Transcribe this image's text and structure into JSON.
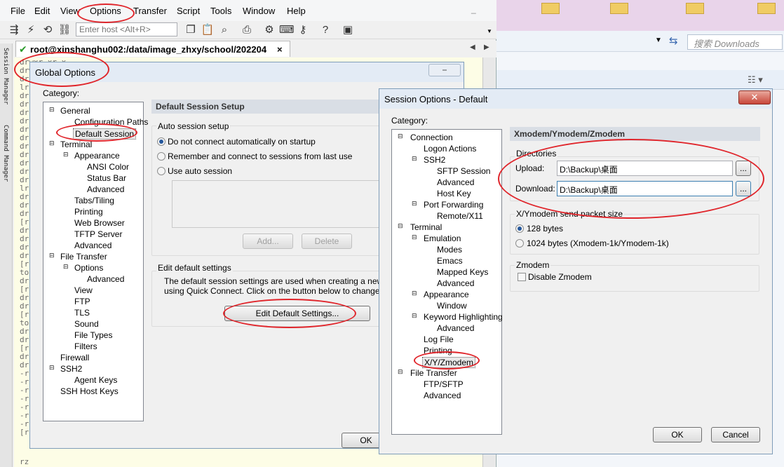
{
  "menubar": {
    "items": [
      "File",
      "Edit",
      "View",
      "Options",
      "Transfer",
      "Script",
      "Tools",
      "Window",
      "Help"
    ]
  },
  "toolbar": {
    "host_placeholder": "Enter host <Alt+R>"
  },
  "session_tab": {
    "label": "root@xinshanghu002:/data/image_zhxy/school/202204",
    "close": "×"
  },
  "side_tabs": [
    "Session Manager",
    "Command Manager"
  ],
  "terminal": {
    "lines": [
      "drwxr-xr-x",
      "drwxr-xr-x",
      "dr",
      "lr",
      "dr",
      "dr",
      "dr",
      "dr",
      "dr",
      "dr",
      "dr",
      "dr",
      "dr",
      "dr",
      "dr",
      "lr",
      "dr",
      "dr",
      "dr",
      "[r",
      "dr",
      "dr",
      "dr",
      "dr",
      "[r",
      "to",
      "dr",
      "[r",
      "dr",
      "dr",
      "[r",
      "to",
      "dr",
      "dr",
      "[r",
      "dr",
      "dr",
      "-r",
      "-r",
      "-r",
      "-r",
      "-r",
      "-r",
      "-r",
      "[r",
      "rz"
    ]
  },
  "explorer": {
    "search_placeholder": "搜索 Downloads"
  },
  "global_options": {
    "title": "Global Options",
    "category_label": "Category:",
    "tree": [
      {
        "label": "General",
        "level": 0,
        "expander": "-"
      },
      {
        "label": "Configuration Paths",
        "level": 1
      },
      {
        "label": "Default Session",
        "level": 1,
        "selected": true
      },
      {
        "label": "Terminal",
        "level": 0,
        "expander": "-"
      },
      {
        "label": "Appearance",
        "level": 1,
        "expander": "-"
      },
      {
        "label": "ANSI Color",
        "level": 2
      },
      {
        "label": "Status Bar",
        "level": 2
      },
      {
        "label": "Advanced",
        "level": 2
      },
      {
        "label": "Tabs/Tiling",
        "level": 1
      },
      {
        "label": "Printing",
        "level": 1
      },
      {
        "label": "Web Browser",
        "level": 1
      },
      {
        "label": "TFTP Server",
        "level": 1
      },
      {
        "label": "Advanced",
        "level": 1
      },
      {
        "label": "File Transfer",
        "level": 0,
        "expander": "-"
      },
      {
        "label": "Options",
        "level": 1,
        "expander": "-"
      },
      {
        "label": "Advanced",
        "level": 2
      },
      {
        "label": "View",
        "level": 1
      },
      {
        "label": "FTP",
        "level": 1
      },
      {
        "label": "TLS",
        "level": 1
      },
      {
        "label": "Sound",
        "level": 1
      },
      {
        "label": "File Types",
        "level": 1
      },
      {
        "label": "Filters",
        "level": 1
      },
      {
        "label": "Firewall",
        "level": 0
      },
      {
        "label": "SSH2",
        "level": 0,
        "expander": "-"
      },
      {
        "label": "Agent Keys",
        "level": 1
      },
      {
        "label": "SSH Host Keys",
        "level": 0
      }
    ],
    "header": "Default Session Setup",
    "auto_group": "Auto session setup",
    "radio_1": "Do not connect automatically on startup",
    "radio_2": "Remember and connect to sessions from last use",
    "radio_3": "Use auto session",
    "add_button": "Add...",
    "delete_button": "Delete",
    "edit_group": "Edit default settings",
    "desc_1": "The default session settings are used when creating a new sess",
    "desc_2": "using Quick Connect.  Click on the button below to change the d",
    "edit_button": "Edit Default Settings...",
    "ok_button": "OK"
  },
  "session_options": {
    "title": "Session Options - Default",
    "category_label": "Category:",
    "tree": [
      {
        "label": "Connection",
        "level": 0,
        "expander": "-"
      },
      {
        "label": "Logon Actions",
        "level": 1
      },
      {
        "label": "SSH2",
        "level": 1,
        "expander": "-"
      },
      {
        "label": "SFTP Session",
        "level": 2
      },
      {
        "label": "Advanced",
        "level": 2
      },
      {
        "label": "Host Key",
        "level": 2
      },
      {
        "label": "Port Forwarding",
        "level": 1,
        "expander": "-"
      },
      {
        "label": "Remote/X11",
        "level": 2
      },
      {
        "label": "Terminal",
        "level": 0,
        "expander": "-"
      },
      {
        "label": "Emulation",
        "level": 1,
        "expander": "-"
      },
      {
        "label": "Modes",
        "level": 2
      },
      {
        "label": "Emacs",
        "level": 2
      },
      {
        "label": "Mapped Keys",
        "level": 2
      },
      {
        "label": "Advanced",
        "level": 2
      },
      {
        "label": "Appearance",
        "level": 1,
        "expander": "-"
      },
      {
        "label": "Window",
        "level": 2
      },
      {
        "label": "Keyword Highlighting",
        "level": 1,
        "expander": "-"
      },
      {
        "label": "Advanced",
        "level": 2
      },
      {
        "label": "Log File",
        "level": 1
      },
      {
        "label": "Printing",
        "level": 1
      },
      {
        "label": "X/Y/Zmodem",
        "level": 1,
        "selected": true
      },
      {
        "label": "File Transfer",
        "level": 0,
        "expander": "-"
      },
      {
        "label": "FTP/SFTP",
        "level": 1
      },
      {
        "label": "Advanced",
        "level": 1
      }
    ],
    "header": "Xmodem/Ymodem/Zmodem",
    "dirs_group": "Directories",
    "upload_label": "Upload:",
    "upload_value": "D:\\Backup\\桌面",
    "download_label": "Download:",
    "download_value": "D:\\Backup\\桌面",
    "browse": "...",
    "packet_group": "X/Ymodem send packet size",
    "packet_128": "128 bytes",
    "packet_1024": "1024 bytes  (Xmodem-1k/Ymodem-1k)",
    "zmodem_group": "Zmodem",
    "disable_zmodem": "Disable Zmodem",
    "ok_button": "OK",
    "cancel_button": "Cancel"
  }
}
